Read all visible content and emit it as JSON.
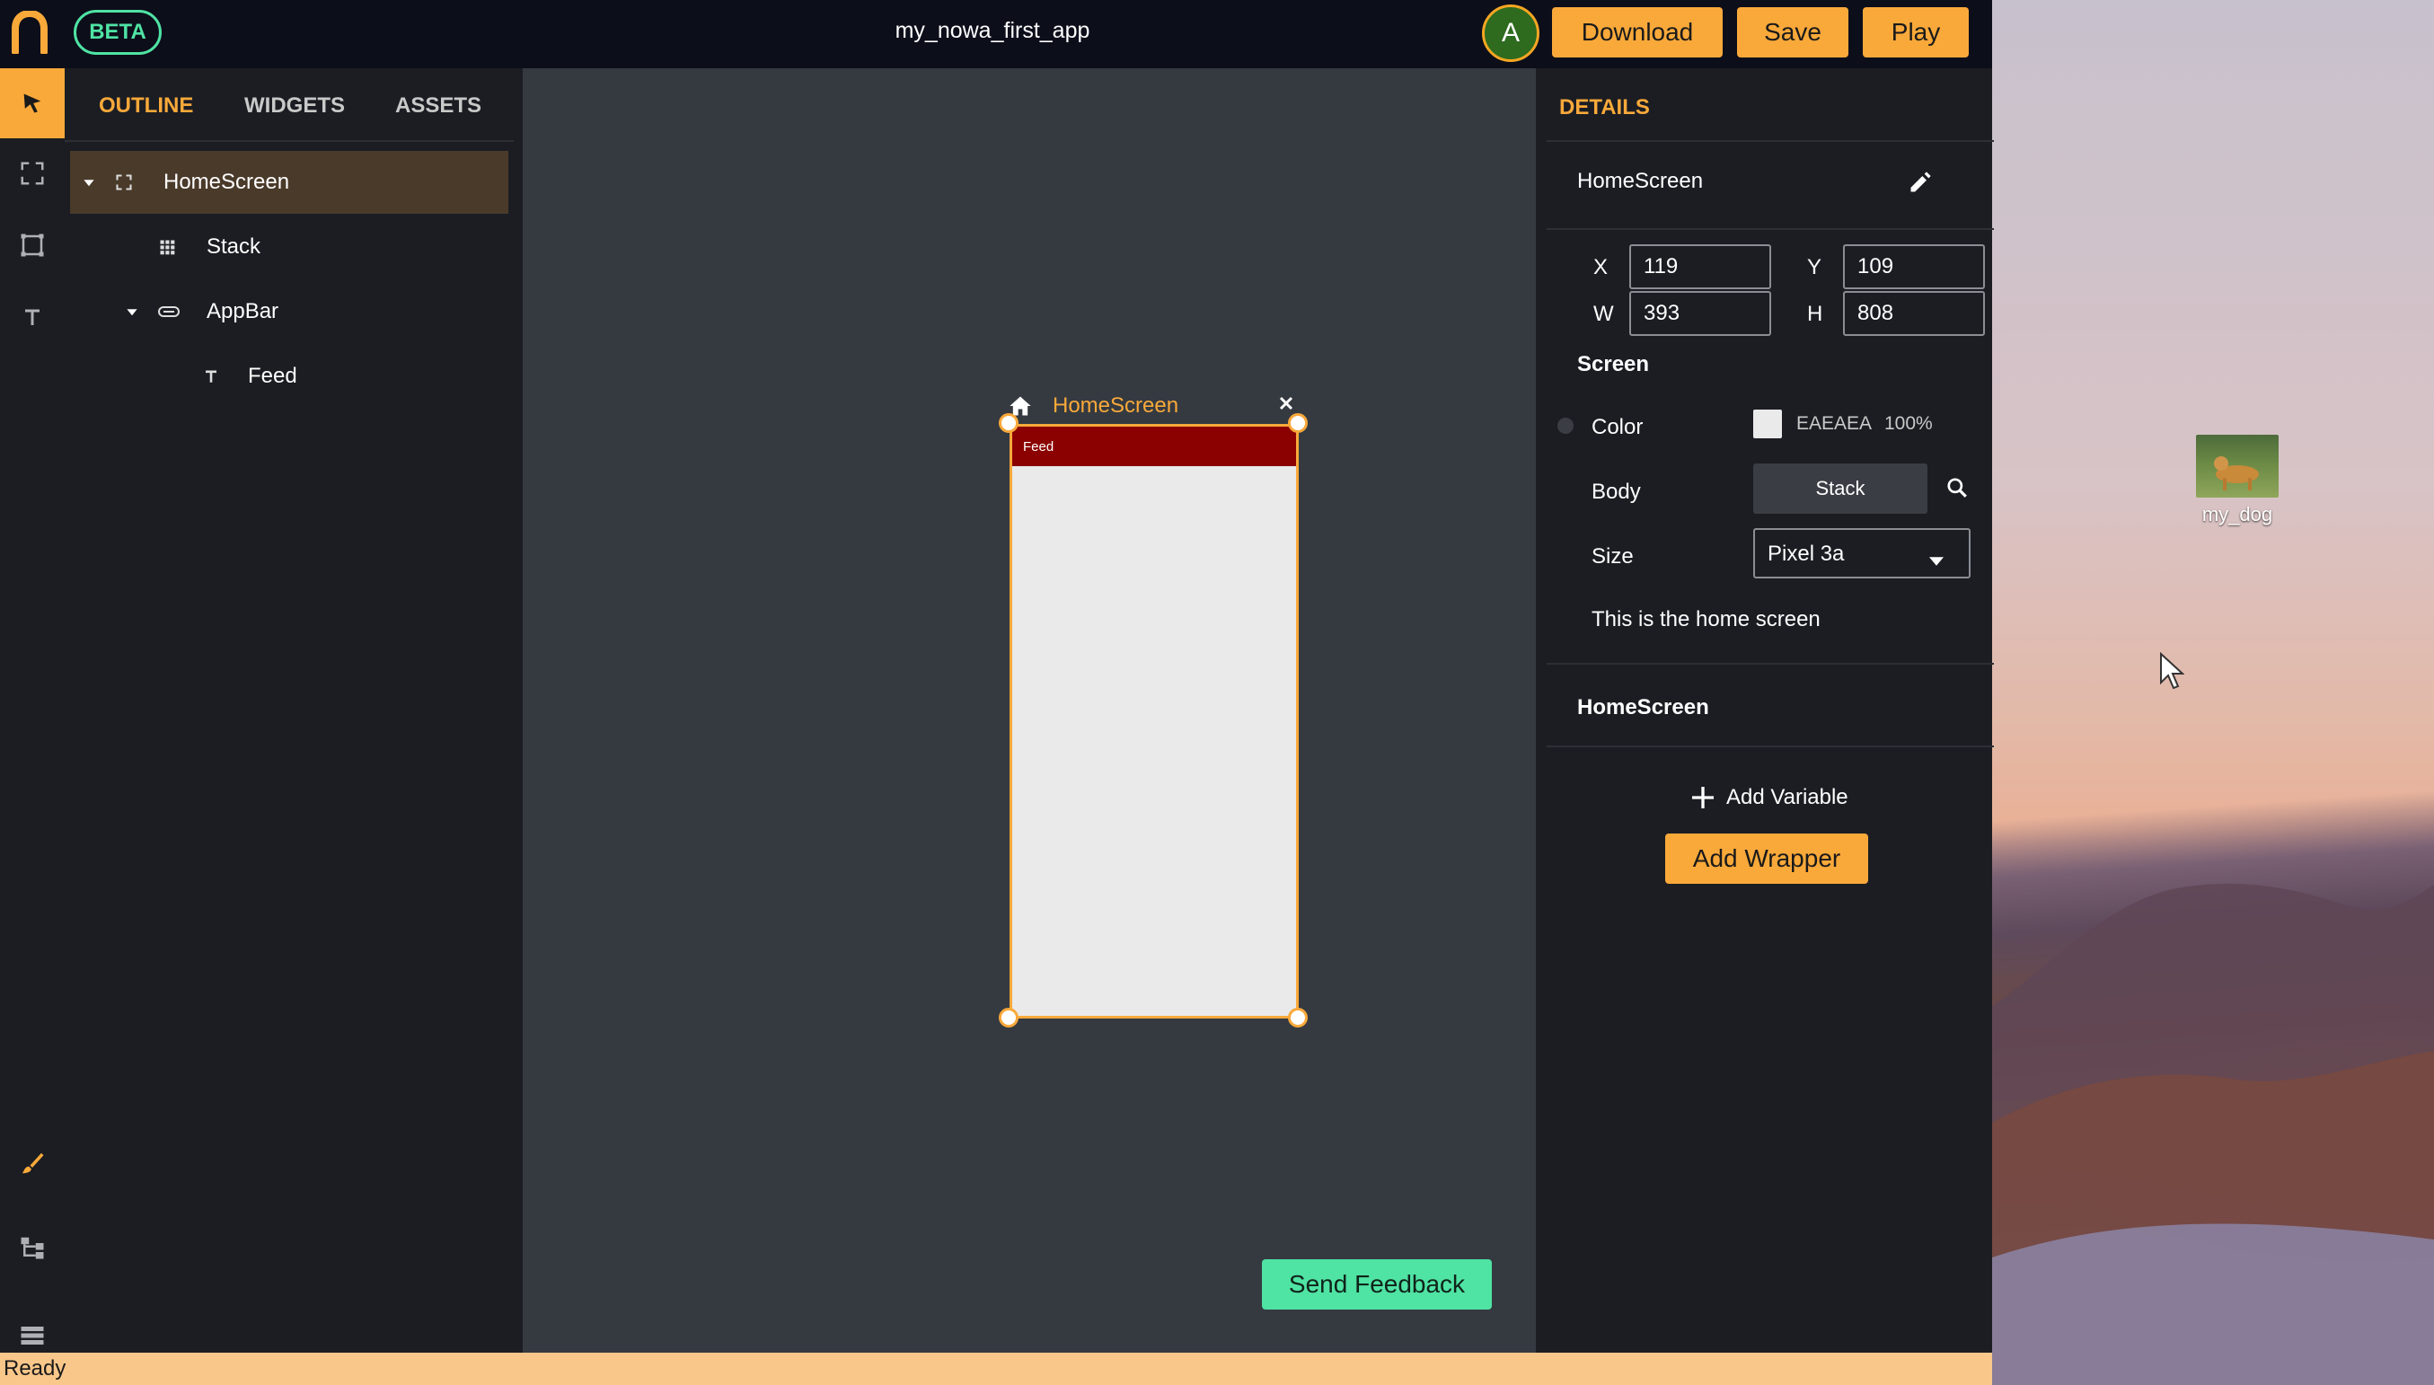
{
  "topbar": {
    "badge": "BETA",
    "app_title": "my_nowa_first_app",
    "avatar_initial": "A",
    "download_label": "Download",
    "save_label": "Save",
    "play_label": "Play"
  },
  "rail": {
    "icons": [
      "select-arrow-icon",
      "fullscreen-icon",
      "frame-icon",
      "text-icon",
      "brush-icon",
      "hierarchy-icon",
      "list-icon"
    ]
  },
  "outline": {
    "tabs": [
      "OUTLINE",
      "WIDGETS",
      "ASSETS"
    ],
    "active_tab": "OUTLINE",
    "tree": [
      {
        "label": "HomeScreen",
        "icon": "screen-icon",
        "expanded": true,
        "selected": true
      },
      {
        "label": "Stack",
        "icon": "grid-icon"
      },
      {
        "label": "AppBar",
        "icon": "appbar-icon",
        "expanded": true
      },
      {
        "label": "Feed",
        "icon": "text-icon"
      }
    ]
  },
  "canvas": {
    "screen_name": "HomeScreen",
    "appbar_text": "Feed",
    "screen_color": "#EAEAEA",
    "appbar_color": "#8B0000",
    "feedback_label": "Send Feedback"
  },
  "details": {
    "heading": "DETAILS",
    "component_name": "HomeScreen",
    "x_label": "X",
    "x_value": "119",
    "y_label": "Y",
    "y_value": "109",
    "w_label": "W",
    "w_value": "393",
    "h_label": "H",
    "h_value": "808",
    "section": "Screen",
    "color_label": "Color",
    "color_hex": "EAEAEA",
    "color_opacity": "100%",
    "body_label": "Body",
    "body_value": "Stack",
    "size_label": "Size",
    "size_value": "Pixel 3a",
    "description": "This is the home screen",
    "variables_heading": "HomeScreen",
    "add_variable_label": "Add Variable",
    "add_wrapper_label": "Add Wrapper"
  },
  "status": {
    "text": "Ready"
  },
  "desktop": {
    "icon_label": "my_dog"
  },
  "colors": {
    "accent": "#F9A93A",
    "beta": "#4FE3A4",
    "feedback": "#4FE3A4",
    "topbar": "#0C0E1A",
    "canvas": "#353A41"
  }
}
